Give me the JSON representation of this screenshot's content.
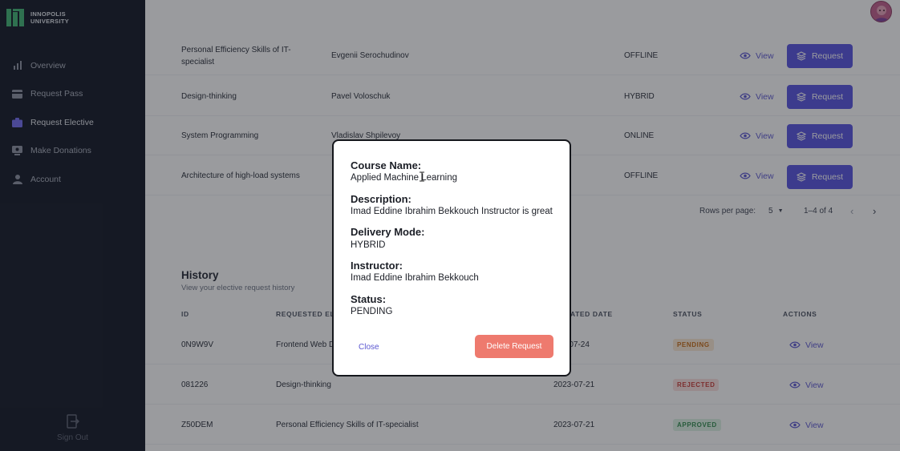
{
  "brand": {
    "line1": "INNOPOLIS",
    "line2": "UNIVERSITY",
    "accent": "#3cb371"
  },
  "sidebar": {
    "items": [
      {
        "label": "Overview",
        "icon": "bar-chart-icon"
      },
      {
        "label": "Request Pass",
        "icon": "card-icon"
      },
      {
        "label": "Request Elective",
        "icon": "briefcase-icon",
        "active": true
      },
      {
        "label": "Make Donations",
        "icon": "donation-icon"
      },
      {
        "label": "Account",
        "icon": "person-icon"
      }
    ],
    "signout": "Sign Out"
  },
  "electives": {
    "rows": [
      {
        "name": "Personal Efficiency Skills of IT-specialist",
        "instructor": "Evgenii Serochudinov",
        "mode": "OFFLINE",
        "view": "View",
        "request": "Request"
      },
      {
        "name": "Design-thinking",
        "instructor": "Pavel Voloschuk",
        "mode": "HYBRID",
        "view": "View",
        "request": "Request"
      },
      {
        "name": "System Programming",
        "instructor": "Vladislav Shpilevoy",
        "mode": "ONLINE",
        "view": "View",
        "request": "Request"
      },
      {
        "name": "Architecture of high-load systems",
        "instructor": "",
        "mode": "OFFLINE",
        "view": "View",
        "request": "Request"
      }
    ],
    "pager": {
      "rows_per_page_label": "Rows per page:",
      "rows_per_page": "5",
      "range": "1–4 of 4"
    }
  },
  "history": {
    "title": "History",
    "subtitle": "View your elective request history",
    "headers": {
      "id": "ID",
      "elective": "REQUESTED ELE",
      "date": "ATED DATE",
      "status": "STATUS",
      "actions": "ACTIONS"
    },
    "rows": [
      {
        "id": "0N9W9V",
        "elective": "Frontend Web D",
        "date": "-07-24",
        "status": "PENDING",
        "view": "View"
      },
      {
        "id": "081226",
        "elective": "Design-thinking",
        "date": "2023-07-21",
        "status": "REJECTED",
        "view": "View"
      },
      {
        "id": "Z50DEM",
        "elective": "Personal Efficiency Skills of IT-specialist",
        "date": "2023-07-21",
        "status": "APPROVED",
        "view": "View"
      }
    ]
  },
  "modal": {
    "course_label": "Course Name:",
    "course_value": "Applied Machine Learning",
    "description_label": "Description:",
    "description_value": "Imad Eddine Ibrahim Bekkouch Instructor is great",
    "delivery_label": "Delivery Mode:",
    "delivery_value": "HYBRID",
    "instructor_label": "Instructor:",
    "instructor_value": "Imad Eddine Ibrahim Bekkouch",
    "status_label": "Status:",
    "status_value": "PENDING",
    "close_label": "Close",
    "delete_label": "Delete Request"
  },
  "colors": {
    "primary": "#5550e0",
    "danger": "#ee7a6e",
    "sidebar_bg": "#0e1322"
  }
}
